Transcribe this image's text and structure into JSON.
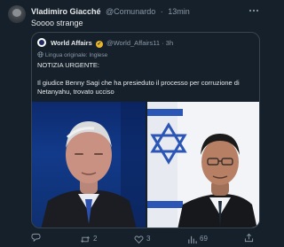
{
  "tweet": {
    "author_name": "Vladimiro Giacché",
    "author_handle": "@Comunardo",
    "separator": "·",
    "time": "13min",
    "text": "Soooo strange",
    "more_icon": "more-horizontal-icon"
  },
  "quote": {
    "author_name": "World Affairs",
    "author_handle": "@World_Affairs11",
    "separator": "·",
    "time": "3h",
    "original_language": "Lingua originale: Inglese",
    "headline": "NOTIZIA URGENTE:",
    "body": "Il giudice Benny Sagi che ha presieduto il processo per corruzione di Netanyahu, trovato ucciso"
  },
  "actions": {
    "reply_count": "",
    "retweet_count": "2",
    "like_count": "3",
    "views_count": "69"
  },
  "colors": {
    "background": "#15202b",
    "border": "#38444d",
    "muted_text": "#8b98a5",
    "badge_gold": "#e8b62d"
  }
}
